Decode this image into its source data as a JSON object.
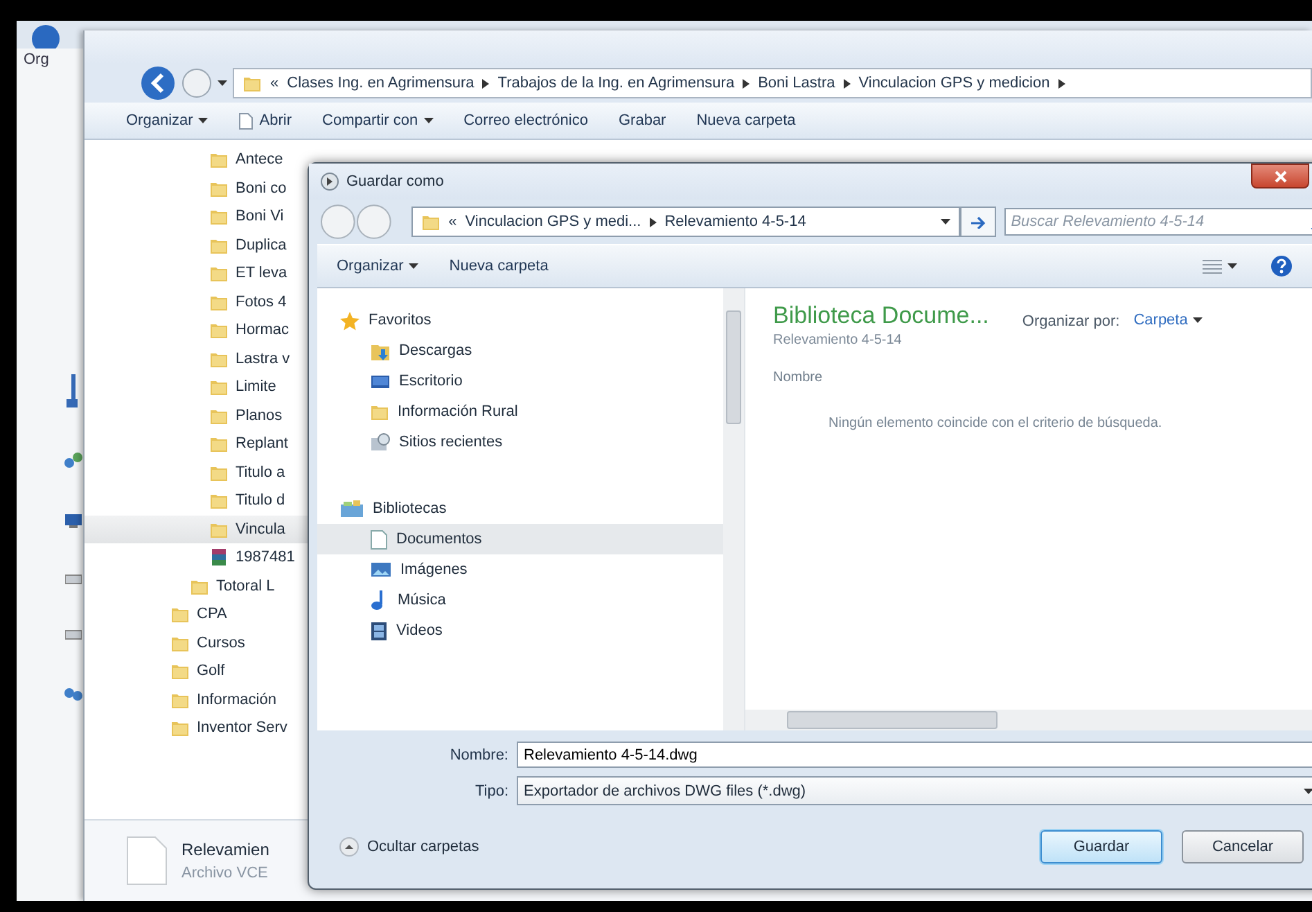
{
  "back_window": {
    "toolbar_label": "Org"
  },
  "explorer": {
    "breadcrumb": {
      "overflow": "«",
      "segments": [
        "Clases Ing. en Agrimensura",
        "Trabajos de la Ing. en Agrimensura",
        "Boni Lastra",
        "Vinculacion GPS y medicion"
      ]
    },
    "toolbar": [
      {
        "label": "Organizar",
        "kind": "menu"
      },
      {
        "label": "Abrir",
        "kind": "document"
      },
      {
        "label": "Compartir con",
        "kind": "menu"
      },
      {
        "label": "Correo electrónico",
        "kind": "plain"
      },
      {
        "label": "Grabar",
        "kind": "plain"
      },
      {
        "label": "Nueva carpeta",
        "kind": "plain"
      }
    ],
    "tree": [
      {
        "children": [
          {
            "children": [
              {
                "label": "Antece",
                "kind": "folder",
                "selected": false
              },
              {
                "label": "Boni co",
                "kind": "folder",
                "selected": false
              },
              {
                "label": "Boni Vi",
                "kind": "folder",
                "selected": false
              },
              {
                "label": "Duplica",
                "kind": "folder",
                "selected": false
              },
              {
                "label": "ET leva",
                "kind": "folder",
                "selected": false
              },
              {
                "label": "Fotos 4",
                "kind": "folder",
                "selected": false
              },
              {
                "label": "Hormac",
                "kind": "folder",
                "selected": false
              },
              {
                "label": "Lastra v",
                "kind": "folder",
                "selected": false
              },
              {
                "label": "Limite",
                "kind": "folder",
                "selected": false
              },
              {
                "label": "Planos",
                "kind": "folder",
                "selected": false
              },
              {
                "label": "Replant",
                "kind": "folder",
                "selected": false
              },
              {
                "label": "Titulo a",
                "kind": "folder",
                "selected": false
              },
              {
                "label": "Titulo d",
                "kind": "folder",
                "selected": false
              },
              {
                "label": "Vincula",
                "kind": "folder",
                "selected": true
              },
              {
                "label": "1987481",
                "kind": "archive",
                "selected": false
              }
            ]
          },
          {
            "label": "Totoral L",
            "kind": "folder",
            "selected": false
          }
        ]
      },
      {
        "label": "CPA",
        "kind": "folder",
        "selected": false
      },
      {
        "label": "Cursos",
        "kind": "folder",
        "selected": false
      },
      {
        "label": "Golf",
        "kind": "folder",
        "selected": false
      },
      {
        "label": "Información",
        "kind": "folder",
        "selected": false
      },
      {
        "label": "Inventor Serv",
        "kind": "folder",
        "selected": false
      }
    ],
    "details": {
      "name": "Relevamien",
      "type": "Archivo VCE"
    }
  },
  "dialog": {
    "title": "Guardar como",
    "address": {
      "overflow": "«",
      "segments": [
        "Vinculacion GPS y medi...",
        "Relevamiento 4-5-14"
      ]
    },
    "search": {
      "placeholder": "Buscar Relevamiento 4-5-14"
    },
    "toolbar": [
      {
        "label": "Organizar",
        "kind": "menu"
      },
      {
        "label": "Nueva carpeta",
        "kind": "plain"
      }
    ],
    "nav_groups": [
      {
        "label": "Favoritos",
        "kind": "star",
        "children": [
          {
            "label": "Descargas",
            "kind": "download",
            "selected": false
          },
          {
            "label": "Escritorio",
            "kind": "desktop",
            "selected": false
          },
          {
            "label": "Información Rural",
            "kind": "folder",
            "selected": false
          },
          {
            "label": "Sitios recientes",
            "kind": "recent",
            "selected": false
          }
        ]
      },
      {
        "label": "Bibliotecas",
        "kind": "library",
        "children": [
          {
            "label": "Documentos",
            "kind": "document",
            "selected": true
          },
          {
            "label": "Imágenes",
            "kind": "image",
            "selected": false
          },
          {
            "label": "Música",
            "kind": "music",
            "selected": false
          },
          {
            "label": "Videos",
            "kind": "video",
            "selected": false
          }
        ]
      }
    ],
    "library": {
      "title": "Biblioteca Docume...",
      "subtitle": "Relevamiento 4-5-14",
      "arrange_label": "Organizar por:",
      "arrange_value": "Carpeta"
    },
    "columns": [
      "Nombre"
    ],
    "empty_message": "Ningún elemento coincide con el criterio de búsqueda.",
    "filename": {
      "label": "Nombre:",
      "value": "Relevamiento 4-5-14.dwg"
    },
    "filetype": {
      "label": "Tipo:",
      "value": "Exportador de archivos DWG files (*.dwg)"
    },
    "hide_folders": "Ocultar carpetas",
    "buttons": [
      {
        "label": "Guardar",
        "default": true
      },
      {
        "label": "Cancelar",
        "default": false
      }
    ]
  }
}
